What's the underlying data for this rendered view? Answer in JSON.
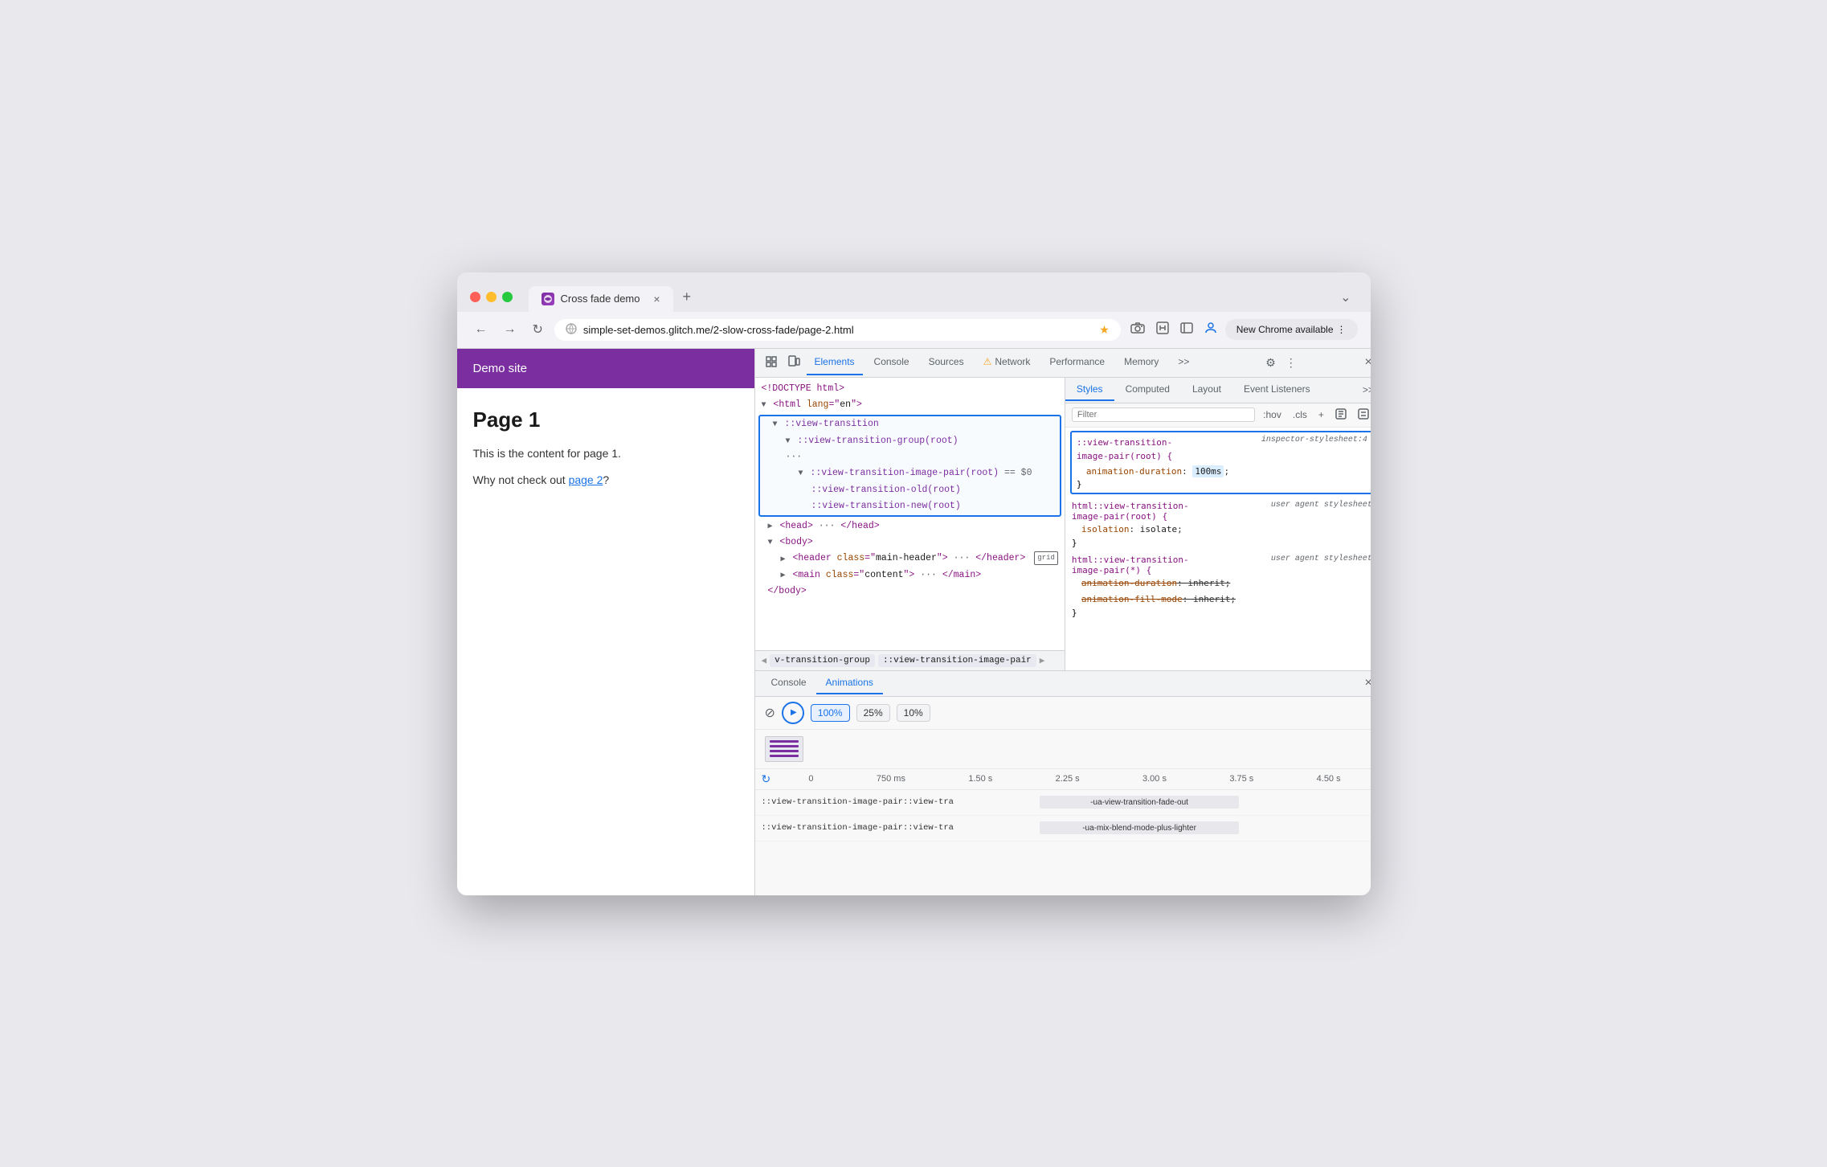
{
  "browser": {
    "tab_title": "Cross fade demo",
    "tab_close": "×",
    "tab_new": "+",
    "tab_dropdown": "⌄",
    "url": "simple-set-demos.glitch.me/2-slow-cross-fade/page-2.html",
    "nav_back": "←",
    "nav_forward": "→",
    "nav_reload": "↻",
    "new_chrome_label": "New Chrome available",
    "nav_more": "⋮"
  },
  "demo_page": {
    "site_title": "Demo site",
    "page_heading": "Page 1",
    "content_p1": "This is the content for page 1.",
    "content_p2": "Why not check out ",
    "content_link": "page 2",
    "content_p2_end": "?"
  },
  "devtools": {
    "tabs": [
      "Elements",
      "Console",
      "Sources",
      "Network",
      "Performance",
      "Memory",
      ">>"
    ],
    "active_tab": "Elements",
    "network_warning": "⚠",
    "close": "×",
    "settings_icon": "⚙",
    "more_icon": "⋮",
    "inspector_icon": "☰",
    "element_picker": "⊡"
  },
  "elements_panel": {
    "lines": [
      {
        "indent": 0,
        "text": "<!DOCTYPE html>"
      },
      {
        "indent": 0,
        "text": "<html lang=\"en\">"
      },
      {
        "indent": 1,
        "caret": "▼",
        "highlight": true,
        "text": "::view-transition"
      },
      {
        "indent": 2,
        "caret": "▼",
        "highlight": true,
        "text": "::view-transition-group(root)"
      },
      {
        "indent": 2,
        "dots": "...",
        "highlight": true
      },
      {
        "indent": 3,
        "caret": "▼",
        "highlight": true,
        "text": "::view-transition-image-pair(root) == $0"
      },
      {
        "indent": 4,
        "highlight": true,
        "text": "::view-transition-old(root)"
      },
      {
        "indent": 4,
        "highlight": true,
        "text": "::view-transition-new(root)"
      },
      {
        "indent": 1,
        "caret": "▶",
        "text": "<head> ··· </head>"
      },
      {
        "indent": 1,
        "caret": "▼",
        "text": "<body>"
      },
      {
        "indent": 2,
        "caret": "▶",
        "text": "<header class=\"main-header\"> ··· </header>",
        "badge": "grid"
      },
      {
        "indent": 2,
        "caret": "▶",
        "text": "<main class=\"content\"> ··· </main>"
      },
      {
        "indent": 1,
        "text": "</body>"
      }
    ]
  },
  "breadcrumb": {
    "items": [
      "v-transition-group",
      "::view-transition-image-pair"
    ],
    "prev": "◀",
    "next": "▶"
  },
  "styles_panel": {
    "tabs": [
      "Styles",
      "Computed",
      "Layout",
      "Event Listeners",
      ">>"
    ],
    "active_tab": "Styles",
    "filter_placeholder": "Filter",
    "hov_btn": ":hov",
    "cls_btn": ".cls",
    "plus_btn": "+",
    "filter_btns": [
      "+",
      "⊞",
      "⊡"
    ],
    "highlight_rule": {
      "selector": "::view-transition-image-pair(root) {",
      "source": "inspector-stylesheet:4",
      "prop": "animation-duration",
      "val": "100ms",
      "closing": "}"
    },
    "rules": [
      {
        "selector": "html::view-transition-image-pair(root) {",
        "source": "user agent stylesheet",
        "props": [
          {
            "name": "isolation",
            "val": "isolate",
            "strikethrough": false
          }
        ],
        "closing": "}"
      },
      {
        "selector": "html::view-transition-image-pair(*) {",
        "source": "user agent stylesheet",
        "props": [
          {
            "name": "animation-duration",
            "val": "inherit",
            "strikethrough": true
          },
          {
            "name": "animation-fill-mode",
            "val": "inherit",
            "strikethrough": false
          }
        ],
        "closing": "}"
      }
    ]
  },
  "bottom_panel": {
    "tabs": [
      "Console",
      "Animations"
    ],
    "active_tab": "Animations",
    "close": "×",
    "anim_cancel": "⊘",
    "anim_play": "▶",
    "speeds": [
      "100%",
      "25%",
      "10%"
    ],
    "active_speed": "100%",
    "timeline_markers": [
      "0",
      "750 ms",
      "1.50 s",
      "2.25 s",
      "3.00 s",
      "3.75 s",
      "4.50 s"
    ],
    "timeline_rows": [
      {
        "label": "::view-transition-image-pair::view-tra",
        "bar_label": "-ua-view-transition-fade-out"
      },
      {
        "label": "::view-transition-image-pair::view-tra",
        "bar_label": "-ua-mix-blend-mode-plus-lighter"
      }
    ]
  }
}
